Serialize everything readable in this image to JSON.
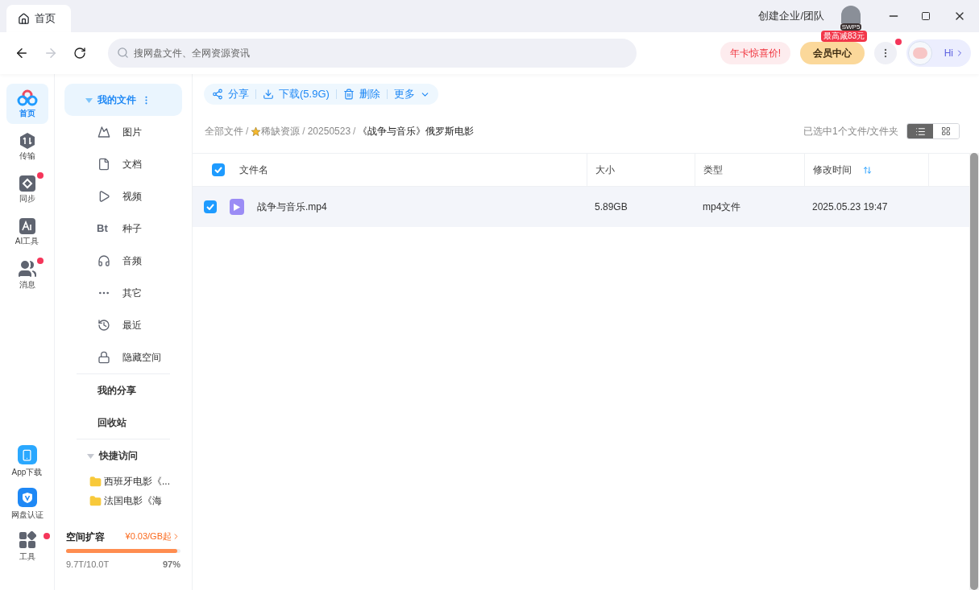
{
  "tab": {
    "label": "首页",
    "selected": true
  },
  "search": {
    "placeholder": "搜网盘文件、全网资源资讯"
  },
  "header": {
    "team": "创建企业/团队",
    "avatar_badge": "SWP5",
    "promo": "年卡惊喜价!",
    "vip": "会员中心",
    "vip_tag": "最高减83元",
    "menu_badge": true,
    "hi": "Hi"
  },
  "rail": [
    {
      "label": "首页",
      "kind": "home",
      "selected": true,
      "badge": false
    },
    {
      "label": "传输",
      "kind": "transfer",
      "selected": false,
      "badge": false
    },
    {
      "label": "同步",
      "kind": "sync",
      "selected": false,
      "badge": true
    },
    {
      "label": "AI工具",
      "kind": "ai",
      "selected": false,
      "badge": false
    },
    {
      "label": "消息",
      "kind": "message",
      "selected": false,
      "badge": true
    }
  ],
  "rail_bottom": [
    {
      "label": "App下载",
      "kind": "phone",
      "badge": false
    },
    {
      "label": "网盘认证",
      "kind": "verify",
      "badge": false
    },
    {
      "label": "工具",
      "kind": "tools",
      "badge": true
    }
  ],
  "sidebar": {
    "my_files": {
      "label": "我的文件",
      "expanded": true,
      "selected": true
    },
    "categories": [
      {
        "label": "图片",
        "kind": "image"
      },
      {
        "label": "文档",
        "kind": "doc"
      },
      {
        "label": "视频",
        "kind": "video"
      },
      {
        "label": "种子",
        "kind": "seed",
        "glyph": "Bt"
      },
      {
        "label": "音频",
        "kind": "audio"
      },
      {
        "label": "其它",
        "kind": "other"
      },
      {
        "label": "最近",
        "kind": "recent"
      },
      {
        "label": "隐藏空间",
        "kind": "lock"
      }
    ],
    "links": [
      "我的分享",
      "回收站"
    ],
    "quick": {
      "label": "快捷访问",
      "expanded": true,
      "items": [
        "西班牙电影《...",
        "法国电影《海"
      ]
    },
    "storage": {
      "label": "空间扩容",
      "offer": "¥0.03/GB起",
      "level": 0.97,
      "used": "9.7T/10.0T",
      "percent": "97%"
    }
  },
  "toolbar": [
    {
      "label": "分享",
      "kind": "share"
    },
    {
      "label": "下载(5.9G)",
      "kind": "download"
    },
    {
      "label": "删除",
      "kind": "delete"
    },
    {
      "label": "更多",
      "kind": "more"
    }
  ],
  "breadcrumb": [
    {
      "label": "全部文件",
      "starred": false,
      "sep": "/"
    },
    {
      "label": "稀缺资源",
      "starred": true,
      "sep": "/"
    },
    {
      "label": "20250523",
      "starred": false,
      "sep": "/"
    },
    {
      "label": "《战争与音乐》俄罗斯电影",
      "starred": false
    }
  ],
  "selection_info": "已选中1个文件/文件夹",
  "view": [
    {
      "kind": "list",
      "selected": true
    },
    {
      "kind": "grid",
      "selected": false
    }
  ],
  "table": {
    "all_checked": true,
    "columns": [
      "文件名",
      "大小",
      "类型",
      "修改时间"
    ],
    "rows": [
      {
        "name": "战争与音乐.mp4",
        "size": "5.89GB",
        "type": "mp4文件",
        "modified": "2025.05.23 19:47",
        "checked": true,
        "selected": true
      }
    ]
  }
}
